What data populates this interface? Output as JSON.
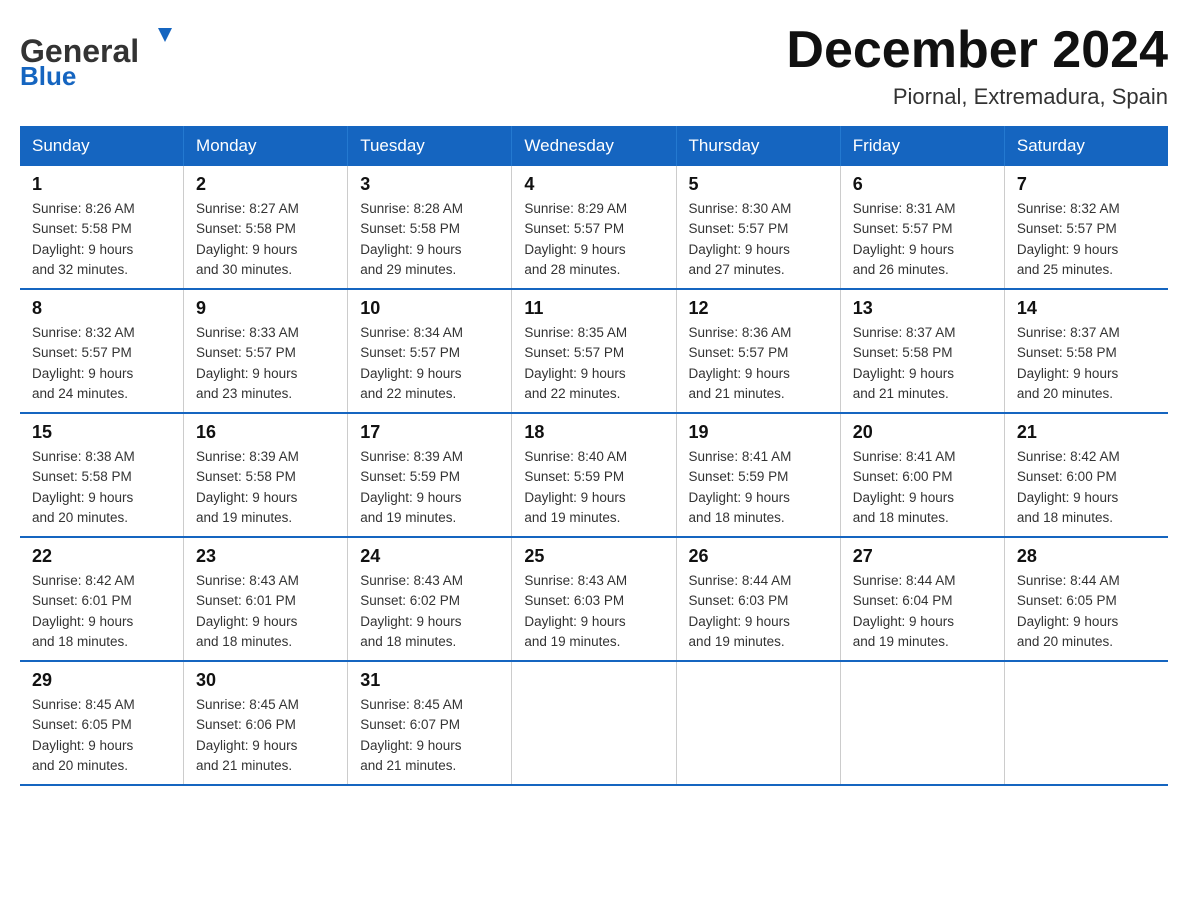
{
  "header": {
    "logo_general": "General",
    "logo_blue": "Blue",
    "title": "December 2024",
    "subtitle": "Piornal, Extremadura, Spain"
  },
  "days_of_week": [
    "Sunday",
    "Monday",
    "Tuesday",
    "Wednesday",
    "Thursday",
    "Friday",
    "Saturday"
  ],
  "weeks": [
    [
      {
        "day": "1",
        "sunrise": "8:26 AM",
        "sunset": "5:58 PM",
        "daylight": "9 hours and 32 minutes."
      },
      {
        "day": "2",
        "sunrise": "8:27 AM",
        "sunset": "5:58 PM",
        "daylight": "9 hours and 30 minutes."
      },
      {
        "day": "3",
        "sunrise": "8:28 AM",
        "sunset": "5:58 PM",
        "daylight": "9 hours and 29 minutes."
      },
      {
        "day": "4",
        "sunrise": "8:29 AM",
        "sunset": "5:57 PM",
        "daylight": "9 hours and 28 minutes."
      },
      {
        "day": "5",
        "sunrise": "8:30 AM",
        "sunset": "5:57 PM",
        "daylight": "9 hours and 27 minutes."
      },
      {
        "day": "6",
        "sunrise": "8:31 AM",
        "sunset": "5:57 PM",
        "daylight": "9 hours and 26 minutes."
      },
      {
        "day": "7",
        "sunrise": "8:32 AM",
        "sunset": "5:57 PM",
        "daylight": "9 hours and 25 minutes."
      }
    ],
    [
      {
        "day": "8",
        "sunrise": "8:32 AM",
        "sunset": "5:57 PM",
        "daylight": "9 hours and 24 minutes."
      },
      {
        "day": "9",
        "sunrise": "8:33 AM",
        "sunset": "5:57 PM",
        "daylight": "9 hours and 23 minutes."
      },
      {
        "day": "10",
        "sunrise": "8:34 AM",
        "sunset": "5:57 PM",
        "daylight": "9 hours and 22 minutes."
      },
      {
        "day": "11",
        "sunrise": "8:35 AM",
        "sunset": "5:57 PM",
        "daylight": "9 hours and 22 minutes."
      },
      {
        "day": "12",
        "sunrise": "8:36 AM",
        "sunset": "5:57 PM",
        "daylight": "9 hours and 21 minutes."
      },
      {
        "day": "13",
        "sunrise": "8:37 AM",
        "sunset": "5:58 PM",
        "daylight": "9 hours and 21 minutes."
      },
      {
        "day": "14",
        "sunrise": "8:37 AM",
        "sunset": "5:58 PM",
        "daylight": "9 hours and 20 minutes."
      }
    ],
    [
      {
        "day": "15",
        "sunrise": "8:38 AM",
        "sunset": "5:58 PM",
        "daylight": "9 hours and 20 minutes."
      },
      {
        "day": "16",
        "sunrise": "8:39 AM",
        "sunset": "5:58 PM",
        "daylight": "9 hours and 19 minutes."
      },
      {
        "day": "17",
        "sunrise": "8:39 AM",
        "sunset": "5:59 PM",
        "daylight": "9 hours and 19 minutes."
      },
      {
        "day": "18",
        "sunrise": "8:40 AM",
        "sunset": "5:59 PM",
        "daylight": "9 hours and 19 minutes."
      },
      {
        "day": "19",
        "sunrise": "8:41 AM",
        "sunset": "5:59 PM",
        "daylight": "9 hours and 18 minutes."
      },
      {
        "day": "20",
        "sunrise": "8:41 AM",
        "sunset": "6:00 PM",
        "daylight": "9 hours and 18 minutes."
      },
      {
        "day": "21",
        "sunrise": "8:42 AM",
        "sunset": "6:00 PM",
        "daylight": "9 hours and 18 minutes."
      }
    ],
    [
      {
        "day": "22",
        "sunrise": "8:42 AM",
        "sunset": "6:01 PM",
        "daylight": "9 hours and 18 minutes."
      },
      {
        "day": "23",
        "sunrise": "8:43 AM",
        "sunset": "6:01 PM",
        "daylight": "9 hours and 18 minutes."
      },
      {
        "day": "24",
        "sunrise": "8:43 AM",
        "sunset": "6:02 PM",
        "daylight": "9 hours and 18 minutes."
      },
      {
        "day": "25",
        "sunrise": "8:43 AM",
        "sunset": "6:03 PM",
        "daylight": "9 hours and 19 minutes."
      },
      {
        "day": "26",
        "sunrise": "8:44 AM",
        "sunset": "6:03 PM",
        "daylight": "9 hours and 19 minutes."
      },
      {
        "day": "27",
        "sunrise": "8:44 AM",
        "sunset": "6:04 PM",
        "daylight": "9 hours and 19 minutes."
      },
      {
        "day": "28",
        "sunrise": "8:44 AM",
        "sunset": "6:05 PM",
        "daylight": "9 hours and 20 minutes."
      }
    ],
    [
      {
        "day": "29",
        "sunrise": "8:45 AM",
        "sunset": "6:05 PM",
        "daylight": "9 hours and 20 minutes."
      },
      {
        "day": "30",
        "sunrise": "8:45 AM",
        "sunset": "6:06 PM",
        "daylight": "9 hours and 21 minutes."
      },
      {
        "day": "31",
        "sunrise": "8:45 AM",
        "sunset": "6:07 PM",
        "daylight": "9 hours and 21 minutes."
      },
      null,
      null,
      null,
      null
    ]
  ],
  "sunrise_label": "Sunrise:",
  "sunset_label": "Sunset:",
  "daylight_label": "Daylight:"
}
